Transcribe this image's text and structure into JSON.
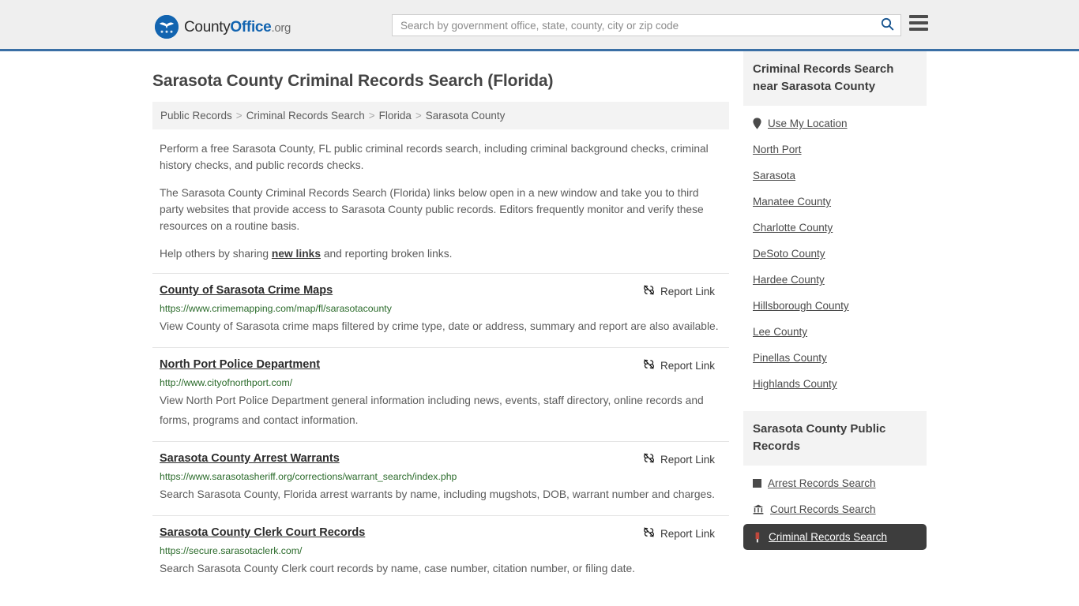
{
  "header": {
    "logo": {
      "part1": "County",
      "part2": "Office",
      "part3": ".org",
      "icon": "eagle-shield-logo-icon",
      "brand_color": "#1264b0"
    },
    "search": {
      "placeholder": "Search by government office, state, county, city or zip code",
      "value": "",
      "search_icon": "magnifier-icon"
    },
    "menu_icon": "hamburger-menu-icon",
    "accent_color": "#3a6fa5"
  },
  "main": {
    "page_title": "Sarasota County Criminal Records Search (Florida)",
    "breadcrumb": [
      "Public Records",
      "Criminal Records Search",
      "Florida",
      "Sarasota County"
    ],
    "breadcrumb_separator": ">",
    "intro": {
      "p1": "Perform a free Sarasota County, FL public criminal records search, including criminal background checks, criminal history checks, and public records checks.",
      "p2": "The Sarasota County Criminal Records Search (Florida) links below open in a new window and take you to third party websites that provide access to Sarasota County public records. Editors frequently monitor and verify these resources on a routine basis.",
      "p3_before": "Help others by sharing ",
      "p3_link": "new links",
      "p3_after": " and reporting broken links."
    },
    "report_link_label": "Report Link",
    "report_link_icon": "broken-link-icon",
    "results": [
      {
        "title": "County of Sarasota Crime Maps",
        "url": "https://www.crimemapping.com/map/fl/sarasotacounty",
        "description": "View County of Sarasota crime maps filtered by crime type, date or address, summary and report are also available."
      },
      {
        "title": "North Port Police Department",
        "url": "http://www.cityofnorthport.com/",
        "description": "View North Port Police Department general information including news, events, staff directory, online records and forms, programs and contact information."
      },
      {
        "title": "Sarasota County Arrest Warrants",
        "url": "https://www.sarasotasheriff.org/corrections/warrant_search/index.php",
        "description": "Search Sarasota County, Florida arrest warrants by name, including mugshots, DOB, warrant number and charges."
      },
      {
        "title": "Sarasota County Clerk Court Records",
        "url": "https://secure.sarasotaclerk.com/",
        "description": "Search Sarasota County Clerk court records by name, case number, citation number, or filing date."
      }
    ]
  },
  "sidebar": {
    "nearby": {
      "heading": "Criminal Records Search near Sarasota County",
      "items": [
        {
          "label": "Use My Location",
          "icon": "map-pin-icon"
        },
        {
          "label": "North Port",
          "icon": ""
        },
        {
          "label": "Sarasota",
          "icon": ""
        },
        {
          "label": "Manatee County",
          "icon": ""
        },
        {
          "label": "Charlotte County",
          "icon": ""
        },
        {
          "label": "DeSoto County",
          "icon": ""
        },
        {
          "label": "Hardee County",
          "icon": ""
        },
        {
          "label": "Hillsborough County",
          "icon": ""
        },
        {
          "label": "Lee County",
          "icon": ""
        },
        {
          "label": "Pinellas County",
          "icon": ""
        },
        {
          "label": "Highlands County",
          "icon": ""
        }
      ]
    },
    "public_records": {
      "heading": "Sarasota County Public Records",
      "items": [
        {
          "label": "Arrest Records Search",
          "icon": "fingerprint-square-icon",
          "active": false
        },
        {
          "label": "Court Records Search",
          "icon": "courthouse-icon",
          "active": false
        },
        {
          "label": "Criminal Records Search",
          "icon": "gavel-icon",
          "active": true
        }
      ]
    },
    "highlight_color": "#3d3d3d"
  }
}
